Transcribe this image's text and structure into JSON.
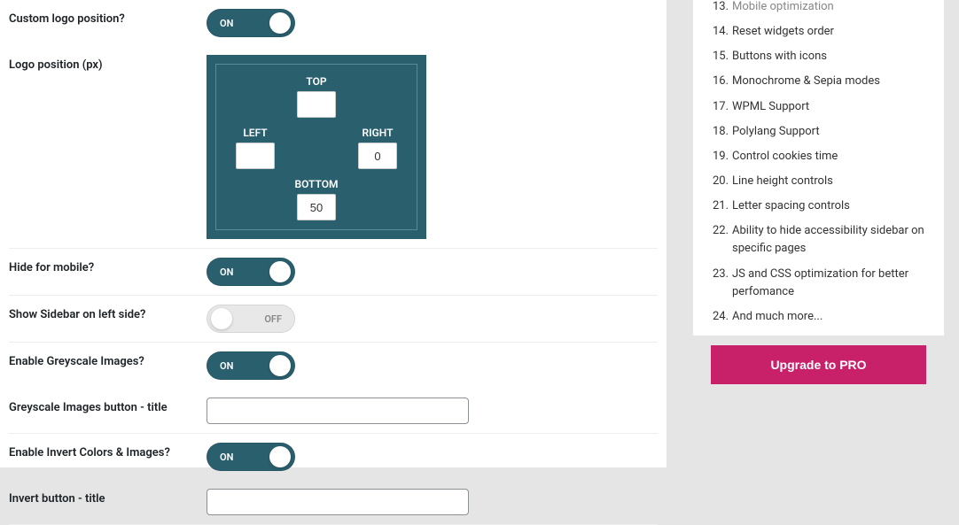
{
  "toggle": {
    "on": "ON",
    "off": "OFF"
  },
  "form": {
    "custom_logo_position": {
      "label": "Custom logo position?",
      "state": "on"
    },
    "logo_position": {
      "label": "Logo position (px)",
      "top_label": "TOP",
      "top_value": "",
      "left_label": "LEFT",
      "left_value": "",
      "right_label": "RIGHT",
      "right_value": "0",
      "bottom_label": "BOTTOM",
      "bottom_value": "50"
    },
    "hide_mobile": {
      "label": "Hide for mobile?",
      "state": "on"
    },
    "sidebar_left": {
      "label": "Show Sidebar on left side?",
      "state": "off"
    },
    "greyscale": {
      "label": "Enable Greyscale Images?",
      "state": "on"
    },
    "greyscale_title": {
      "label": "Greyscale Images button - title",
      "value": ""
    },
    "invert": {
      "label": "Enable Invert Colors & Images?",
      "state": "on"
    },
    "invert_title": {
      "label": "Invert button - title",
      "value": ""
    }
  },
  "sidebar": {
    "items": [
      "Mobile optimization",
      "Reset widgets order",
      "Buttons with icons",
      "Monochrome & Sepia modes",
      "WPML Support",
      "Polylang Support",
      "Control cookies time",
      "Line height controls",
      "Letter spacing controls",
      "Ability to hide accessibility sidebar on specific pages",
      "JS and CSS optimization for better perfomance",
      "And much more..."
    ],
    "upgrade_label": "Upgrade to PRO"
  }
}
